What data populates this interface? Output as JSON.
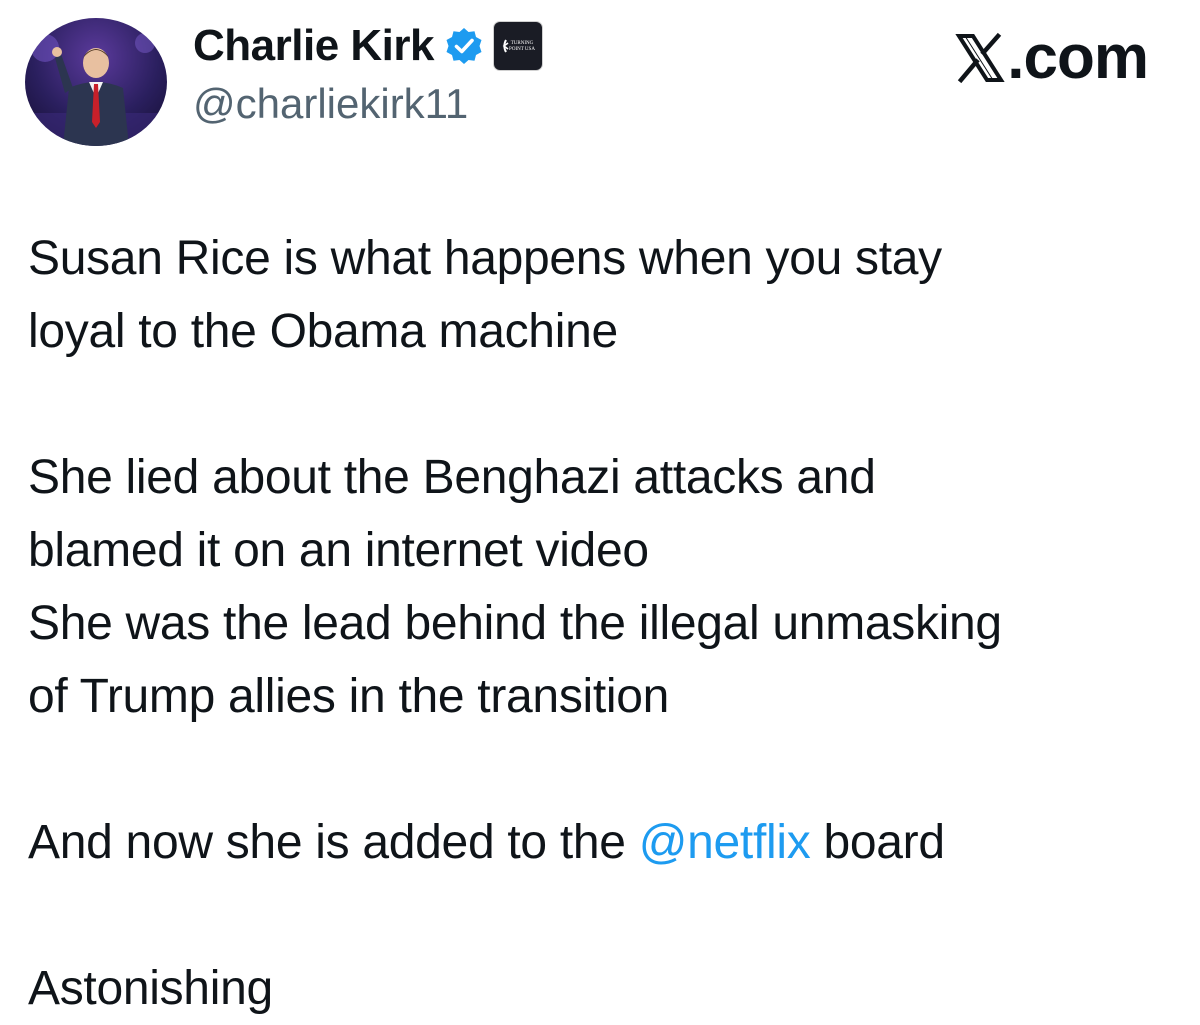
{
  "author": {
    "display_name": "Charlie Kirk",
    "handle": "@charliekirk11",
    "verified_icon": "verified-badge-icon",
    "verified_color": "#1d9bf0",
    "affiliate_icon": "turning-point-usa-logo",
    "affiliate_logo_text": "TURNING POINT USA"
  },
  "brand": {
    "suffix": ".com"
  },
  "tweet": {
    "line_1": "Susan Rice is what happens when you stay",
    "line_2": "loyal to the Obama machine",
    "line_3": "She lied about the Benghazi attacks and",
    "line_4": "blamed it on an internet video",
    "line_5": "She was the lead behind the illegal unmasking",
    "line_6": "of Trump allies in the transition",
    "line_7_before": "And now she is added to the ",
    "line_7_mention": "@netflix",
    "line_7_after": " board",
    "line_8": "Astonishing",
    "mention_color": "#1d9bf0"
  }
}
